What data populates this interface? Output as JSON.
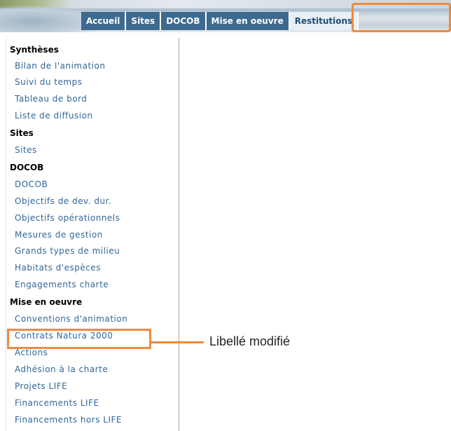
{
  "nav": {
    "tabs": [
      {
        "label": "Accueil"
      },
      {
        "label": "Sites"
      },
      {
        "label": "DOCOB"
      },
      {
        "label": "Mise en oeuvre"
      },
      {
        "label": "Restitutions",
        "active": true
      }
    ]
  },
  "menu": {
    "sections": [
      {
        "title": "Synthèses",
        "items": [
          "Bilan de l'animation",
          "Suivi du temps",
          "Tableau de bord",
          "Liste de diffusion"
        ]
      },
      {
        "title": "Sites",
        "items": [
          "Sites"
        ]
      },
      {
        "title": "DOCOB",
        "items": [
          "DOCOB",
          "Objectifs de dev. dur.",
          "Objectifs opérationnels",
          "Mesures de gestion",
          "Grands types de milieu",
          "Habitats d'espèces",
          "Engagements charte"
        ]
      },
      {
        "title": "Mise en oeuvre",
        "items": [
          "Conventions d'animation",
          "Contrats Natura 2000",
          "Actions",
          "Adhésion à la charte",
          "Projets LIFE",
          "Financements LIFE",
          "Financements hors LIFE"
        ]
      }
    ]
  },
  "callout": {
    "label": "Libellé modifié"
  },
  "colors": {
    "tab_bg": "#3e6a8f",
    "link": "#336699",
    "highlight": "#f08a3c"
  }
}
